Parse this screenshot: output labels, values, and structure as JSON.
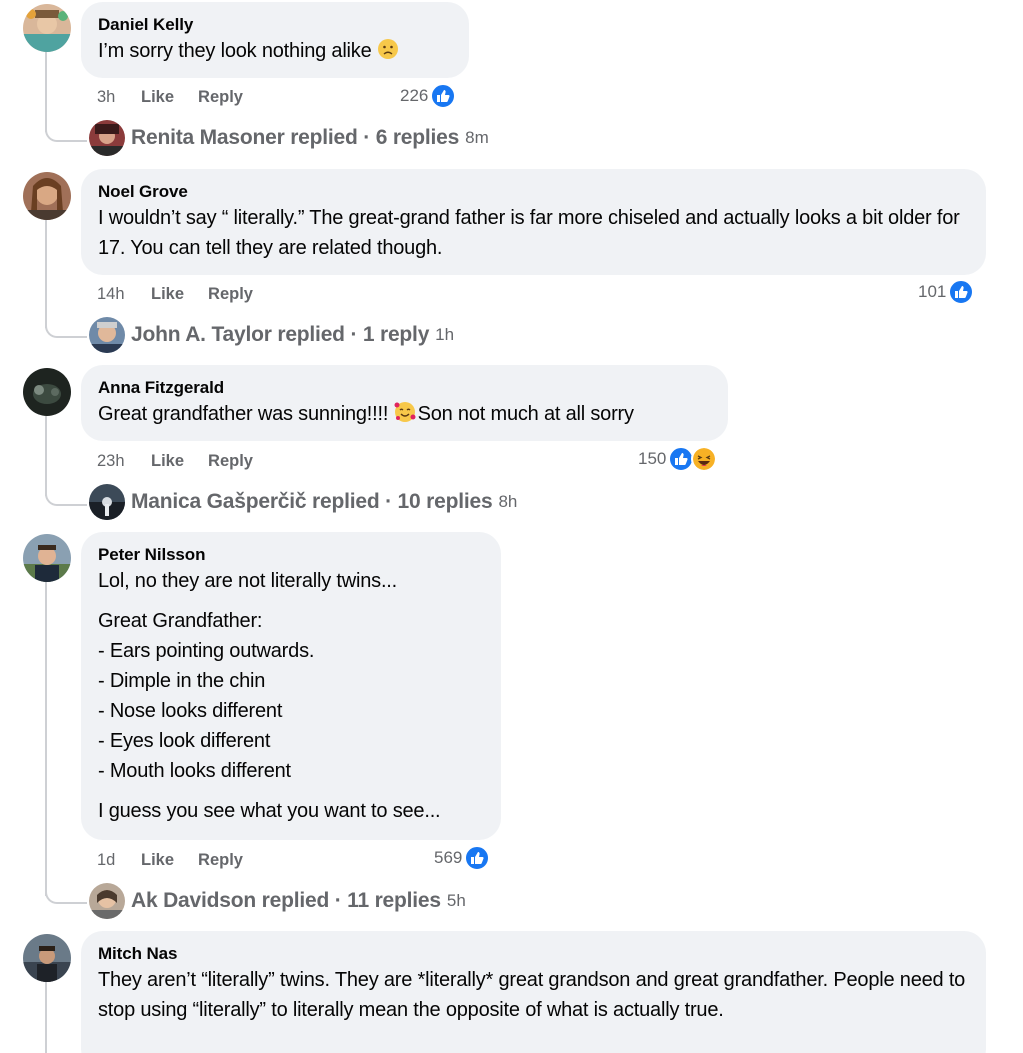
{
  "comments": [
    {
      "author": "Daniel Kelly",
      "paragraphs": [
        "I’m sorry they look nothing alike"
      ],
      "emoji": "sad-face-emoji",
      "time": "3h",
      "like_label": "Like",
      "reply_label": "Reply",
      "reaction_count": "226",
      "reaction_types": [
        "like-icon"
      ],
      "reply_summary": {
        "name": "Renita Masoner replied · 6 replies",
        "ago": "8m"
      }
    },
    {
      "author": "Noel Grove",
      "paragraphs": [
        "I wouldn’t say “ literally.” The great-grand father is far more chiseled and actually looks a bit older for 17. You can tell they are related though."
      ],
      "time": "14h",
      "like_label": "Like",
      "reply_label": "Reply",
      "reaction_count": "101",
      "reaction_types": [
        "like-icon"
      ],
      "reply_summary": {
        "name": "John A. Taylor replied · 1 reply",
        "ago": "1h"
      }
    },
    {
      "author": "Anna Fitzgerald",
      "paragraphs_pre": "Great grandfather was sunning!!!! ",
      "paragraphs_post": "Son not much at all sorry",
      "emoji": "smiling-face-with-hearts-emoji",
      "time": "23h",
      "like_label": "Like",
      "reply_label": "Reply",
      "reaction_count": "150",
      "reaction_types": [
        "like-icon",
        "haha-icon"
      ],
      "reply_summary": {
        "name": "Manica Gašperčič replied · 10 replies",
        "ago": "8h"
      }
    },
    {
      "author": "Peter Nilsson",
      "paragraphs": [
        "Lol, no they are not literally twins...",
        "Great Grandfather:",
        "- Ears pointing outwards.",
        "- Dimple in the chin",
        "- Nose looks different",
        "- Eyes look different",
        "- Mouth looks different",
        "I guess you see what you want to see..."
      ],
      "time": "1d",
      "like_label": "Like",
      "reply_label": "Reply",
      "reaction_count": "569",
      "reaction_types": [
        "like-icon"
      ],
      "reply_summary": {
        "name": "Ak Davidson replied · 11 replies",
        "ago": "5h"
      }
    },
    {
      "author": "Mitch Nas",
      "paragraphs": [
        "They aren’t “literally” twins. They are *literally* great grandson and great grandfather. People need to stop using “literally” to literally mean the opposite of what is actually true."
      ]
    }
  ],
  "colors": {
    "bubble": "#f0f2f5",
    "meta_text": "#65676b",
    "like_blue": "#1877f2",
    "thread_line": "#ced0d4"
  }
}
